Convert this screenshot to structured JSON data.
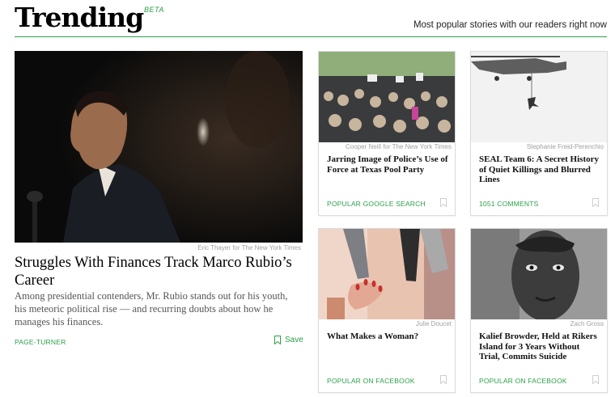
{
  "header": {
    "title": "Trending",
    "beta": "BETA",
    "tagline": "Most popular stories with our readers right now"
  },
  "lead": {
    "credit": "Eric Thayer for The New York Times",
    "headline": "Struggles With Finances Track Marco Rubio’s Career",
    "summary": "Among presidential contenders, Mr. Rubio stands out for his youth, his meteoric political rise — and recurring doubts about how he manages his finances.",
    "kicker": "PAGE-TURNER",
    "save_label": "Save"
  },
  "cards": [
    {
      "credit": "Cooper Neill for The New York Times",
      "headline": "Jarring Image of Police’s Use of Force at Texas Pool Party",
      "kicker": "POPULAR GOOGLE SEARCH"
    },
    {
      "credit": "Stephanie Freid-Perenchio",
      "headline": "SEAL Team 6: A Secret History of Quiet Killings and Blurred Lines",
      "kicker": "1051 COMMENTS"
    },
    {
      "credit": "Julie Doucet",
      "headline": "What Makes a Woman?",
      "kicker": "POPULAR ON FACEBOOK"
    },
    {
      "credit": "Zach Gross",
      "headline": "Kalief Browder, Held at Rikers Island for 3 Years Without Trial, Commits Suicide",
      "kicker": "POPULAR ON FACEBOOK"
    }
  ],
  "colors": {
    "accent": "#2ba14a",
    "rule": "#2ba14a",
    "text": "#121212",
    "muted": "#555555"
  },
  "icons": {
    "save": "bookmark-icon",
    "card_bookmark": "bookmark-icon"
  }
}
